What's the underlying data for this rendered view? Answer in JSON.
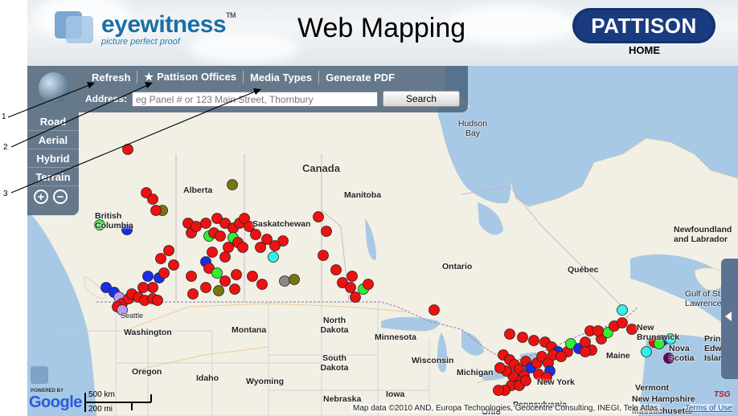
{
  "header": {
    "logo_text": "eyewitness",
    "logo_tm": "TM",
    "tagline": "picture perfect proof",
    "title": "Web Mapping",
    "brand": "PATTISON",
    "home_label": "HOME"
  },
  "toolbar": {
    "refresh_label": "Refresh",
    "offices_label": "Pattison Offices",
    "media_label": "Media Types",
    "pdf_label": "Generate PDF",
    "address_label": "Address:",
    "address_placeholder": "eg Panel # or 123 Main Street, Thornbury",
    "search_label": "Search"
  },
  "map_types": {
    "road": "Road",
    "aerial": "Aerial",
    "hybrid": "Hybrid",
    "terrain": "Terrain"
  },
  "annotations": [
    "1",
    "2",
    "3"
  ],
  "map_labels": {
    "canada": "Canada",
    "hudson_bay": "Hudson Bay",
    "alberta": "Alberta",
    "manitoba": "Manitoba",
    "saskatchewan": "Saskatchewan",
    "british_columbia": "British Columbia",
    "ontario": "Ontario",
    "quebec": "Québec",
    "newfoundland": "Newfoundland and Labrador",
    "gulf": "Gulf of St. Lawrence",
    "new_brunswick": "New Brunswick",
    "nova_scotia": "Nova Scotia",
    "pei": "Prince Edward Island",
    "washington": "Washington",
    "oregon": "Oregon",
    "idaho": "Idaho",
    "montana": "Montana",
    "wyoming": "Wyoming",
    "north_dakota": "North Dakota",
    "south_dakota": "South Dakota",
    "nebraska": "Nebraska",
    "iowa": "Iowa",
    "minnesota": "Minnesota",
    "wisconsin": "Wisconsin",
    "michigan": "Michigan",
    "new_york": "New York",
    "vermont": "Vermont",
    "new_hampshire": "New Hampshire",
    "massachusetts": "Massachusetts",
    "maine": "Maine",
    "pennsylvania": "Pennsylvania",
    "ohio": "Ohio",
    "seattle": "Seattle"
  },
  "footer": {
    "powered_by": "POWERED BY",
    "google": "Google",
    "scale_km": "500 km",
    "scale_mi": "200 mi",
    "attribution": "Map data ©2010 AND, Europa Technologies, Geocentre Consulting, INEGI, Tele Atlas",
    "terms": "Terms of Use",
    "tsg": "TSG"
  },
  "colors": {
    "marker_red": "#ee1111",
    "marker_green": "#33ee33",
    "marker_blue": "#1a2ee8",
    "marker_cyan": "#33eeee",
    "marker_olive": "#777711",
    "marker_gray": "#888888",
    "marker_purple": "#660066",
    "marker_lavender": "#bb99ee",
    "panel": "#465f78",
    "brand_navy": "#1b3b80"
  }
}
